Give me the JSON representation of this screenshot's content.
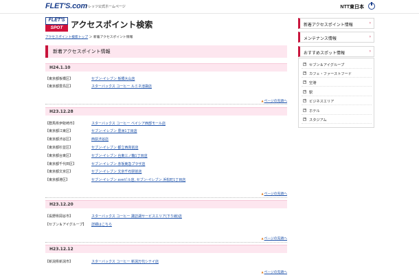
{
  "header": {
    "brand": "FLET'S.com",
    "brand_sub": "フレッツ公式ホームページ",
    "corp": "NTT東日本"
  },
  "logo": {
    "top": "FLET'S",
    "bottom": "SPOT"
  },
  "page": {
    "title": "アクセスポイント検索",
    "breadcrumb_link": "アクセスポイント検索トップ",
    "breadcrumb_sep": "＞",
    "breadcrumb_current": "新着アクセスポイント情報"
  },
  "section_title": "新着アクセスポイント情報",
  "pagetop_label": "ページの先頭へ",
  "groups": [
    {
      "date": "H24.1.10",
      "rows": [
        {
          "area": "【東京都板橋区】",
          "shop": "セブン-イレブン 板橋大山店"
        },
        {
          "area": "【東京都豊島区】",
          "shop": "スターバックス コーヒー ルミネ池袋店"
        }
      ]
    },
    {
      "date": "H23.12.28",
      "rows": [
        {
          "area": "【群馬県伊勢崎市】",
          "shop": "スターバックス コーヒー べイシア西部モール店"
        },
        {
          "area": "【東京都江東区】",
          "shop": "セブン-イレブン 豊洲1丁目店"
        },
        {
          "area": "【東京都渋谷区】",
          "shop": "西荻渋谷店"
        },
        {
          "area": "【東京都杉並区】",
          "shop": "セブン-イレブン 都立西高前店"
        },
        {
          "area": "【東京都台東区】",
          "shop": "セブン-イレブン 台東三ノ輪1丁目店"
        },
        {
          "area": "【東京都千代田区】",
          "shop": "セブン-イレブン 赤坂東急プラザ店"
        },
        {
          "area": "【東京都文京区】",
          "shop": "セブン-イレブン 文京千石駅前店"
        },
        {
          "area": "【東京都港区】",
          "shop": "セブン-イレブン aveビル店, セブン-イレブン 浜松町1丁目店"
        }
      ]
    },
    {
      "date": "H23.12.20",
      "rows": [
        {
          "area": "【長野県岡谷市】",
          "shop": "スターバックス コーヒー 諏訪湖サービスエリア(下り線)店"
        },
        {
          "area": "【セブン＆アイグループ】",
          "shop": "詳細はこちら"
        }
      ]
    },
    {
      "date": "H23.12.12",
      "rows": [
        {
          "area": "【新潟県新潟市】",
          "shop": "スターバックス コーヒー 新潟万代シテイ店"
        }
      ]
    }
  ],
  "sidebar": {
    "buttons": [
      "新着アクセスポイント情報",
      "メンテナンス情報",
      "おすすめスポット情報"
    ],
    "arrow": "›",
    "items": [
      "セブン＆アイグループ",
      "カフェ・ファーストフード",
      "空港",
      "駅",
      "ビジネスエリア",
      "ホテル",
      "スタジアム"
    ],
    "plus": "+"
  },
  "colors": {
    "accent": "#c8143c",
    "link": "#1a4fa8",
    "band": "#fde6ef",
    "brand": "#1a3e8c"
  }
}
